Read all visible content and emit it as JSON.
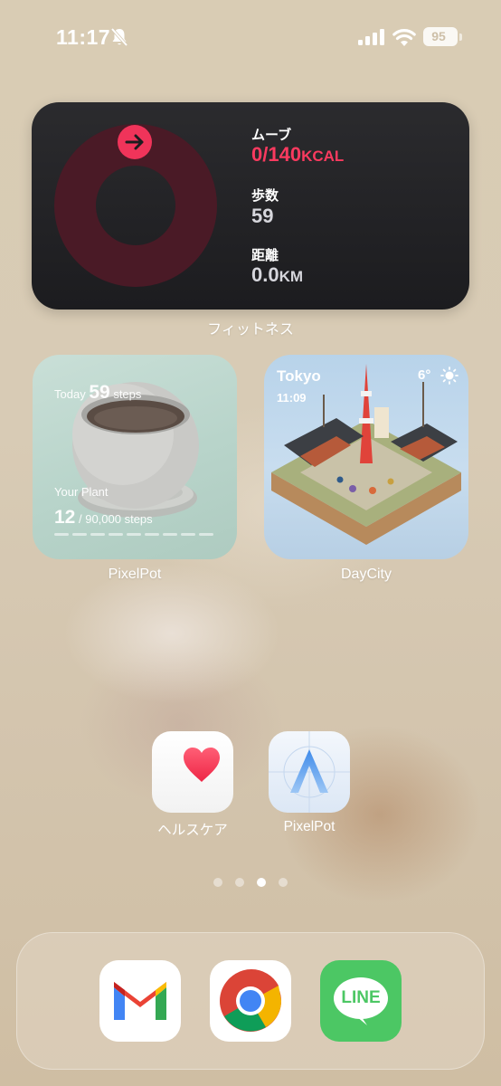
{
  "status_bar": {
    "time": "11:17",
    "battery": "95"
  },
  "fitness_widget": {
    "caption": "フィットネス",
    "move": {
      "label": "ムーブ",
      "value": "0/140",
      "unit": "KCAL",
      "progress": 0,
      "color": "#fa3a5f"
    },
    "steps": {
      "label": "歩数",
      "value": "59"
    },
    "distance": {
      "label": "距離",
      "value": "0.0",
      "unit": "KM"
    }
  },
  "pixelpot_widget": {
    "caption": "PixelPot",
    "today_label": "Today",
    "today_steps": "59",
    "today_unit": "steps",
    "plant_label": "Your Plant",
    "plant_steps": "12",
    "plant_goal": "/ 90,000 steps",
    "progress": 0.0001
  },
  "daycity_widget": {
    "caption": "DayCity",
    "city": "Tokyo",
    "time": "11:09",
    "temperature": "6°",
    "weather_icon": "sun-icon"
  },
  "apps": [
    {
      "label": "ヘルスケア",
      "icon": "heart-icon"
    },
    {
      "label": "PixelPot",
      "icon": "pixelpot-a-icon"
    }
  ],
  "page_indicator": {
    "pages": 4,
    "current": 3
  },
  "dock": [
    {
      "name": "Gmail",
      "icon": "gmail-icon"
    },
    {
      "name": "Chrome",
      "icon": "chrome-icon"
    },
    {
      "name": "LINE",
      "icon": "line-icon",
      "text": "LINE"
    }
  ]
}
